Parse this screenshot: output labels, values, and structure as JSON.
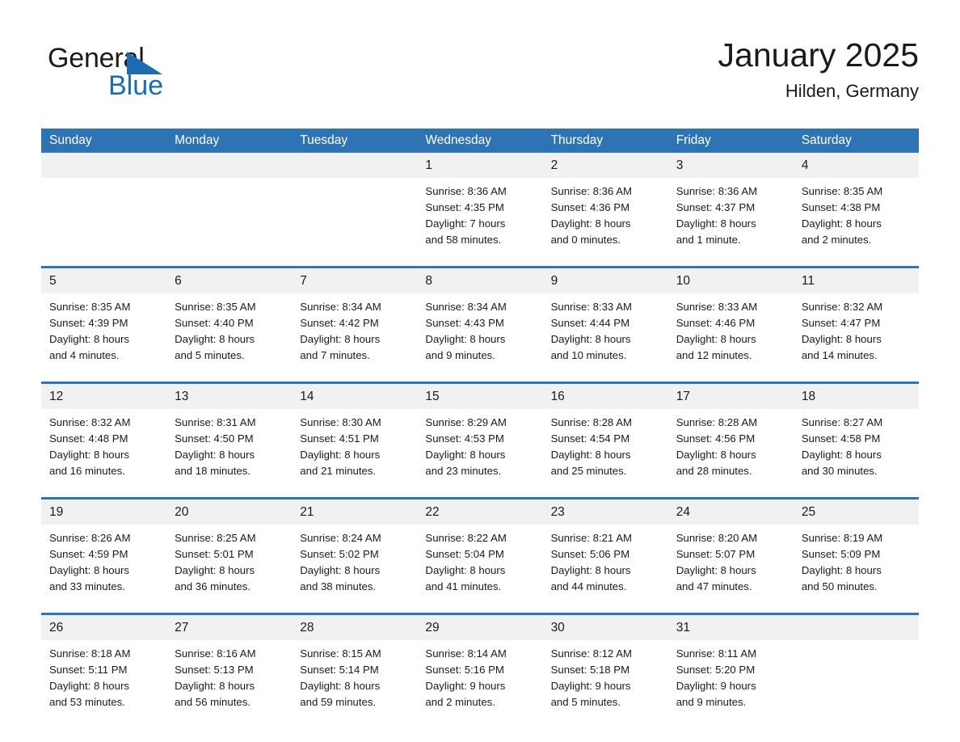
{
  "brand": {
    "name_part1": "General",
    "name_part2": "Blue",
    "accent_color": "#1b6cb0"
  },
  "header": {
    "title": "January 2025",
    "subtitle": "Hilden, Germany"
  },
  "theme": {
    "header_blue": "#2e74b5",
    "date_band_gray": "#f1f1f1",
    "text_color": "#1a1a1a"
  },
  "weekday_headers": [
    "Sunday",
    "Monday",
    "Tuesday",
    "Wednesday",
    "Thursday",
    "Friday",
    "Saturday"
  ],
  "weeks": [
    {
      "days": [
        {
          "date": "",
          "sunrise": "",
          "sunset": "",
          "daylight_a": "",
          "daylight_b": ""
        },
        {
          "date": "",
          "sunrise": "",
          "sunset": "",
          "daylight_a": "",
          "daylight_b": ""
        },
        {
          "date": "",
          "sunrise": "",
          "sunset": "",
          "daylight_a": "",
          "daylight_b": ""
        },
        {
          "date": "1",
          "sunrise": "Sunrise: 8:36 AM",
          "sunset": "Sunset: 4:35 PM",
          "daylight_a": "Daylight: 7 hours",
          "daylight_b": "and 58 minutes."
        },
        {
          "date": "2",
          "sunrise": "Sunrise: 8:36 AM",
          "sunset": "Sunset: 4:36 PM",
          "daylight_a": "Daylight: 8 hours",
          "daylight_b": "and 0 minutes."
        },
        {
          "date": "3",
          "sunrise": "Sunrise: 8:36 AM",
          "sunset": "Sunset: 4:37 PM",
          "daylight_a": "Daylight: 8 hours",
          "daylight_b": "and 1 minute."
        },
        {
          "date": "4",
          "sunrise": "Sunrise: 8:35 AM",
          "sunset": "Sunset: 4:38 PM",
          "daylight_a": "Daylight: 8 hours",
          "daylight_b": "and 2 minutes."
        }
      ]
    },
    {
      "days": [
        {
          "date": "5",
          "sunrise": "Sunrise: 8:35 AM",
          "sunset": "Sunset: 4:39 PM",
          "daylight_a": "Daylight: 8 hours",
          "daylight_b": "and 4 minutes."
        },
        {
          "date": "6",
          "sunrise": "Sunrise: 8:35 AM",
          "sunset": "Sunset: 4:40 PM",
          "daylight_a": "Daylight: 8 hours",
          "daylight_b": "and 5 minutes."
        },
        {
          "date": "7",
          "sunrise": "Sunrise: 8:34 AM",
          "sunset": "Sunset: 4:42 PM",
          "daylight_a": "Daylight: 8 hours",
          "daylight_b": "and 7 minutes."
        },
        {
          "date": "8",
          "sunrise": "Sunrise: 8:34 AM",
          "sunset": "Sunset: 4:43 PM",
          "daylight_a": "Daylight: 8 hours",
          "daylight_b": "and 9 minutes."
        },
        {
          "date": "9",
          "sunrise": "Sunrise: 8:33 AM",
          "sunset": "Sunset: 4:44 PM",
          "daylight_a": "Daylight: 8 hours",
          "daylight_b": "and 10 minutes."
        },
        {
          "date": "10",
          "sunrise": "Sunrise: 8:33 AM",
          "sunset": "Sunset: 4:46 PM",
          "daylight_a": "Daylight: 8 hours",
          "daylight_b": "and 12 minutes."
        },
        {
          "date": "11",
          "sunrise": "Sunrise: 8:32 AM",
          "sunset": "Sunset: 4:47 PM",
          "daylight_a": "Daylight: 8 hours",
          "daylight_b": "and 14 minutes."
        }
      ]
    },
    {
      "days": [
        {
          "date": "12",
          "sunrise": "Sunrise: 8:32 AM",
          "sunset": "Sunset: 4:48 PM",
          "daylight_a": "Daylight: 8 hours",
          "daylight_b": "and 16 minutes."
        },
        {
          "date": "13",
          "sunrise": "Sunrise: 8:31 AM",
          "sunset": "Sunset: 4:50 PM",
          "daylight_a": "Daylight: 8 hours",
          "daylight_b": "and 18 minutes."
        },
        {
          "date": "14",
          "sunrise": "Sunrise: 8:30 AM",
          "sunset": "Sunset: 4:51 PM",
          "daylight_a": "Daylight: 8 hours",
          "daylight_b": "and 21 minutes."
        },
        {
          "date": "15",
          "sunrise": "Sunrise: 8:29 AM",
          "sunset": "Sunset: 4:53 PM",
          "daylight_a": "Daylight: 8 hours",
          "daylight_b": "and 23 minutes."
        },
        {
          "date": "16",
          "sunrise": "Sunrise: 8:28 AM",
          "sunset": "Sunset: 4:54 PM",
          "daylight_a": "Daylight: 8 hours",
          "daylight_b": "and 25 minutes."
        },
        {
          "date": "17",
          "sunrise": "Sunrise: 8:28 AM",
          "sunset": "Sunset: 4:56 PM",
          "daylight_a": "Daylight: 8 hours",
          "daylight_b": "and 28 minutes."
        },
        {
          "date": "18",
          "sunrise": "Sunrise: 8:27 AM",
          "sunset": "Sunset: 4:58 PM",
          "daylight_a": "Daylight: 8 hours",
          "daylight_b": "and 30 minutes."
        }
      ]
    },
    {
      "days": [
        {
          "date": "19",
          "sunrise": "Sunrise: 8:26 AM",
          "sunset": "Sunset: 4:59 PM",
          "daylight_a": "Daylight: 8 hours",
          "daylight_b": "and 33 minutes."
        },
        {
          "date": "20",
          "sunrise": "Sunrise: 8:25 AM",
          "sunset": "Sunset: 5:01 PM",
          "daylight_a": "Daylight: 8 hours",
          "daylight_b": "and 36 minutes."
        },
        {
          "date": "21",
          "sunrise": "Sunrise: 8:24 AM",
          "sunset": "Sunset: 5:02 PM",
          "daylight_a": "Daylight: 8 hours",
          "daylight_b": "and 38 minutes."
        },
        {
          "date": "22",
          "sunrise": "Sunrise: 8:22 AM",
          "sunset": "Sunset: 5:04 PM",
          "daylight_a": "Daylight: 8 hours",
          "daylight_b": "and 41 minutes."
        },
        {
          "date": "23",
          "sunrise": "Sunrise: 8:21 AM",
          "sunset": "Sunset: 5:06 PM",
          "daylight_a": "Daylight: 8 hours",
          "daylight_b": "and 44 minutes."
        },
        {
          "date": "24",
          "sunrise": "Sunrise: 8:20 AM",
          "sunset": "Sunset: 5:07 PM",
          "daylight_a": "Daylight: 8 hours",
          "daylight_b": "and 47 minutes."
        },
        {
          "date": "25",
          "sunrise": "Sunrise: 8:19 AM",
          "sunset": "Sunset: 5:09 PM",
          "daylight_a": "Daylight: 8 hours",
          "daylight_b": "and 50 minutes."
        }
      ]
    },
    {
      "days": [
        {
          "date": "26",
          "sunrise": "Sunrise: 8:18 AM",
          "sunset": "Sunset: 5:11 PM",
          "daylight_a": "Daylight: 8 hours",
          "daylight_b": "and 53 minutes."
        },
        {
          "date": "27",
          "sunrise": "Sunrise: 8:16 AM",
          "sunset": "Sunset: 5:13 PM",
          "daylight_a": "Daylight: 8 hours",
          "daylight_b": "and 56 minutes."
        },
        {
          "date": "28",
          "sunrise": "Sunrise: 8:15 AM",
          "sunset": "Sunset: 5:14 PM",
          "daylight_a": "Daylight: 8 hours",
          "daylight_b": "and 59 minutes."
        },
        {
          "date": "29",
          "sunrise": "Sunrise: 8:14 AM",
          "sunset": "Sunset: 5:16 PM",
          "daylight_a": "Daylight: 9 hours",
          "daylight_b": "and 2 minutes."
        },
        {
          "date": "30",
          "sunrise": "Sunrise: 8:12 AM",
          "sunset": "Sunset: 5:18 PM",
          "daylight_a": "Daylight: 9 hours",
          "daylight_b": "and 5 minutes."
        },
        {
          "date": "31",
          "sunrise": "Sunrise: 8:11 AM",
          "sunset": "Sunset: 5:20 PM",
          "daylight_a": "Daylight: 9 hours",
          "daylight_b": "and 9 minutes."
        },
        {
          "date": "",
          "sunrise": "",
          "sunset": "",
          "daylight_a": "",
          "daylight_b": ""
        }
      ]
    }
  ]
}
